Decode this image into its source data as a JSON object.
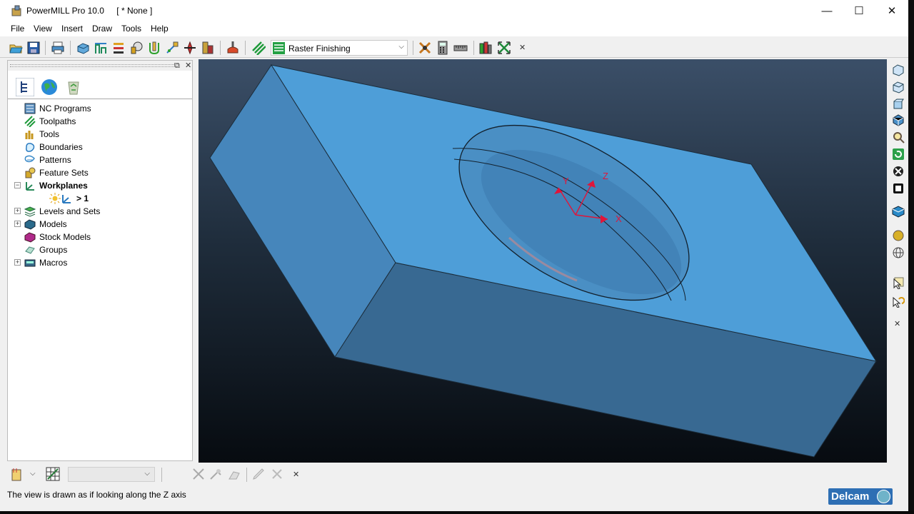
{
  "window": {
    "app_name": "PowerMILL Pro 10.0",
    "project": "[ * None ]",
    "minimize_glyph": "—",
    "maximize_glyph": "☐",
    "close_glyph": "✕"
  },
  "menu": [
    "File",
    "View",
    "Insert",
    "Draw",
    "Tools",
    "Help"
  ],
  "toolbar": {
    "active_strategy": "Raster Finishing",
    "dropdown_glyph": "⌵",
    "close_glyph": "✕",
    "icons": [
      "open-project-icon",
      "save-project-icon",
      "print-icon",
      "block-icon",
      "rapid-move-heights-icon",
      "start-end-point-icon",
      "feeds-speeds-icon",
      "leads-links-icon",
      "point-distribution-icon",
      "tool-axis-icon",
      "machine-tool-icon",
      "toolpath-strategies-icon",
      "toolpath-verify-icon",
      "calculator-icon",
      "measure-icon",
      "workplane-align-icon",
      "expand-arrows-icon"
    ]
  },
  "explorer": {
    "restore_glyph": "⧉",
    "close_glyph": "✕",
    "expand_glyph": "+",
    "collapse_glyph": "−",
    "tabs": [
      "explorer-tree-tab",
      "globe-tab",
      "recycle-bin-tab"
    ],
    "items": [
      {
        "label": "NC Programs",
        "icon": "nc-programs-icon",
        "expander": "none",
        "bold": false
      },
      {
        "label": "Toolpaths",
        "icon": "toolpaths-icon",
        "expander": "none",
        "bold": false
      },
      {
        "label": "Tools",
        "icon": "tools-icon",
        "expander": "none",
        "bold": false
      },
      {
        "label": "Boundaries",
        "icon": "boundaries-icon",
        "expander": "none",
        "bold": false
      },
      {
        "label": "Patterns",
        "icon": "patterns-icon",
        "expander": "none",
        "bold": false
      },
      {
        "label": "Feature Sets",
        "icon": "feature-sets-icon",
        "expander": "none",
        "bold": false
      },
      {
        "label": "Workplanes",
        "icon": "workplanes-icon",
        "expander": "minus",
        "bold": true
      },
      {
        "label": "> 1",
        "icon": "workplane-active-icon",
        "expander": "none",
        "bold": true,
        "child": true
      },
      {
        "label": "Levels and Sets",
        "icon": "levels-icon",
        "expander": "plus",
        "bold": false
      },
      {
        "label": "Models",
        "icon": "models-icon",
        "expander": "plus",
        "bold": false
      },
      {
        "label": "Stock Models",
        "icon": "stock-models-icon",
        "expander": "none",
        "bold": false
      },
      {
        "label": "Groups",
        "icon": "groups-icon",
        "expander": "none",
        "bold": false
      },
      {
        "label": "Macros",
        "icon": "macros-icon",
        "expander": "plus",
        "bold": false
      }
    ]
  },
  "viewport": {
    "axis_labels": {
      "x": "X",
      "y": "Y",
      "z": "Z"
    },
    "colors": {
      "top_face": "#4e9ed8",
      "left_face": "#4686bb",
      "front_face": "#386992",
      "axis": "#e0153a"
    }
  },
  "view_toolbar": {
    "icons": [
      "view-iso1-icon",
      "view-iso2-icon",
      "view-iso3-icon",
      "view-iso4-icon",
      "zoom-icon",
      "refresh-icon",
      "resize-to-fit-icon",
      "zoom-box-icon",
      "block-view-icon",
      "shaded-icon",
      "wireframe-icon",
      "select-icon",
      "undo-select-icon"
    ],
    "close_glyph": "✕"
  },
  "bottom_toolbar": {
    "close_glyph": "✕",
    "combo_arrow": "⌵"
  },
  "status": {
    "message": "The view is drawn as if looking along the Z axis"
  },
  "brand": {
    "logo_text": "Delcam"
  }
}
